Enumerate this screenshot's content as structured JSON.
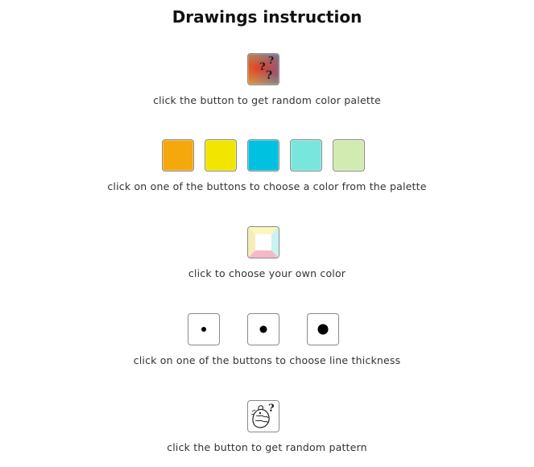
{
  "page": {
    "title": "Drawings instruction"
  },
  "steps": {
    "random_palette": {
      "caption": "click the button to get random color palette",
      "icon": "random-palette-icon"
    },
    "palette": {
      "caption": "click on one of the buttons to choose a color from the palette",
      "colors": [
        "#f5a80c",
        "#f2e600",
        "#00c2e0",
        "#79e6de",
        "#d2ebb0"
      ]
    },
    "own_color": {
      "caption": "click to choose your own color",
      "icon": "color-picker-icon",
      "edge_colors": {
        "top": "#fbf6bd",
        "right": "#c9f3f0",
        "bottom": "#f4b9c8",
        "left": "#f6ecb8"
      }
    },
    "thickness": {
      "caption": "click on one of the buttons to choose line thickness",
      "levels": [
        "thin",
        "medium",
        "thick"
      ]
    },
    "random_pattern": {
      "caption": "click the button to get random pattern",
      "icon": "random-pattern-icon"
    }
  }
}
